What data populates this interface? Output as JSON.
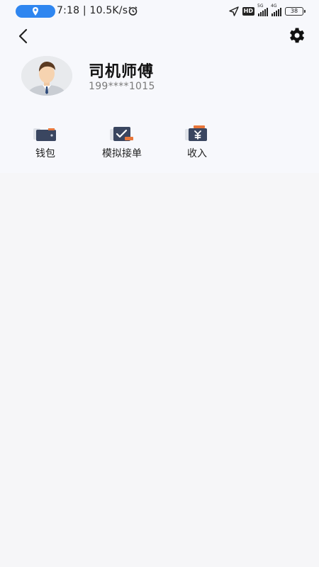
{
  "status_bar": {
    "time_speed": "7:18 | 10.5K/s",
    "hd": "HD",
    "net1": "5G",
    "net2": "4G",
    "battery": "38"
  },
  "icons": {
    "back": "chevron-left-icon",
    "settings": "gear-icon",
    "location": "location-pin-icon",
    "alarm": "alarm-clock-icon",
    "nav_arrow": "navigation-arrow-icon"
  },
  "profile": {
    "name": "司机师傅",
    "phone": "199****1015"
  },
  "menu": {
    "items": [
      {
        "label": "钱包",
        "icon": "wallet-icon"
      },
      {
        "label": "模拟接单",
        "icon": "order-accept-icon"
      },
      {
        "label": "收入",
        "icon": "income-yen-icon"
      }
    ]
  },
  "colors": {
    "accent": "#2f86f0",
    "icon_dark": "#3a4660",
    "icon_orange": "#e8763a"
  }
}
